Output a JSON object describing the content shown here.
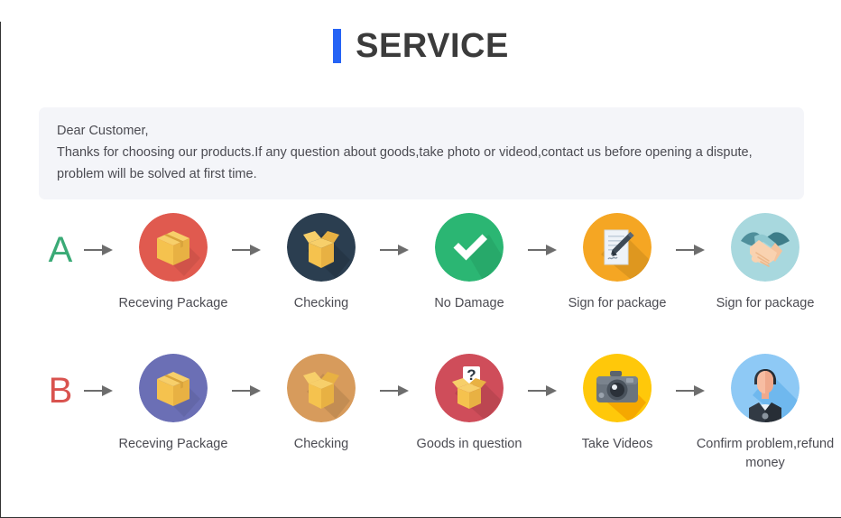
{
  "header": {
    "accent_color": "#2563f5",
    "title": "SERVICE"
  },
  "notice": {
    "line1": "Dear Customer,",
    "line2": "Thanks for choosing our products.If any question about goods,take photo or videod,contact us before opening a dispute,",
    "line3": "problem will be solved at first time."
  },
  "arrow_icon": "arrow-right-icon",
  "rows": [
    {
      "letter": "A",
      "letter_color": "#3aaa76",
      "steps": [
        {
          "label": "Receving Package",
          "icon": "closed-box-icon",
          "circle_color": "#e05a4f"
        },
        {
          "label": "Checking",
          "icon": "open-box-icon",
          "circle_color": "#2b3e50"
        },
        {
          "label": "No Damage",
          "icon": "check-mark-icon",
          "circle_color": "#2bb673"
        },
        {
          "label": "Sign for package",
          "icon": "document-pen-icon",
          "circle_color": "#f5a623"
        },
        {
          "label": "Sign for package",
          "icon": "handshake-icon",
          "circle_color": "#a8d8de"
        }
      ]
    },
    {
      "letter": "B",
      "letter_color": "#d9534f",
      "steps": [
        {
          "label": "Receving Package",
          "icon": "closed-box-icon",
          "circle_color": "#6b6fb5"
        },
        {
          "label": "Checking",
          "icon": "open-box-icon",
          "circle_color": "#d79b5c"
        },
        {
          "label": "Goods in question",
          "icon": "question-box-icon",
          "circle_color": "#cf4d5a"
        },
        {
          "label": "Take Videos",
          "icon": "camera-icon",
          "circle_color": "#ffc80a"
        },
        {
          "label": "Confirm problem,refund money",
          "icon": "person-avatar-icon",
          "circle_color": "#8ec9f5"
        }
      ]
    }
  ]
}
